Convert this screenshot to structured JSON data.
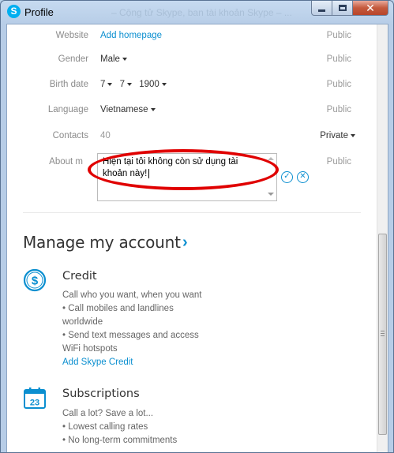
{
  "window": {
    "title": "Profile",
    "background_title": "– Cộng tử Skype, ban tài khoản Skype – ...",
    "minimize_icon": "minimize-icon",
    "maximize_icon": "maximize-icon",
    "close_icon": "close-icon",
    "app_icon": "skype-icon"
  },
  "profile": {
    "website": {
      "label": "Website",
      "value": "Add homepage",
      "visibility": "Public"
    },
    "gender": {
      "label": "Gender",
      "value": "Male",
      "visibility": "Public"
    },
    "birth_date": {
      "label": "Birth date",
      "day": "7",
      "month": "7",
      "year": "1900",
      "visibility": "Public"
    },
    "language": {
      "label": "Language",
      "value": "Vietnamese",
      "visibility": "Public"
    },
    "contacts": {
      "label": "Contacts",
      "value": "40",
      "visibility": "Private"
    },
    "about_me": {
      "label": "About m",
      "value": "Hiện tại tôi không còn sử dụng tài khoản này!",
      "visibility": "Public"
    }
  },
  "manage": {
    "title": "Manage my account",
    "credit": {
      "title": "Credit",
      "icon": "dollar-icon",
      "lines": [
        "Call who you want, when you want",
        "• Call mobiles and landlines",
        "worldwide",
        "• Send text messages and access",
        "WiFi hotspots"
      ],
      "link": "Add Skype Credit"
    },
    "subscriptions": {
      "title": "Subscriptions",
      "icon": "calendar-icon",
      "calendar_day": "23",
      "lines": [
        "Call a lot? Save a lot...",
        "• Lowest calling rates",
        "• No long-term commitments"
      ]
    }
  },
  "colors": {
    "accent": "#0b8fd0",
    "highlight": "#e00000"
  }
}
